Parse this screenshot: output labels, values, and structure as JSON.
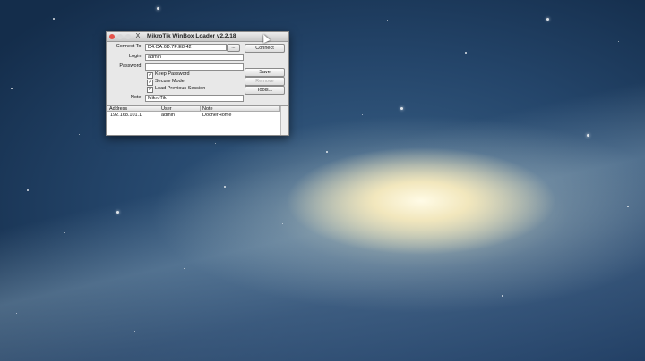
{
  "window": {
    "title": "MikroTik WinBox Loader v2.2.18",
    "tool_icon": "X"
  },
  "form": {
    "connect_to_label": "Connect To:",
    "connect_to_value": "D4:CA:6D:7F:E8:42",
    "browse_label": "...",
    "login_label": "Login:",
    "login_value": "admin",
    "password_label": "Password:",
    "password_value": "",
    "keep_password_label": "Keep Password",
    "secure_mode_label": "Secure Mode",
    "load_previous_label": "Load Previous Session",
    "note_label": "Note:",
    "note_value": "MikroTik",
    "checkbox_mark": "✓"
  },
  "buttons": {
    "connect": "Connect",
    "save": "Save",
    "remove": "Remove",
    "tools": "Tools..."
  },
  "table": {
    "columns": [
      "Address",
      "User",
      "Note"
    ],
    "rows": [
      [
        "192.168.101.1",
        "admin",
        "DocherHome"
      ]
    ]
  },
  "colors": {
    "close_button": "#e5524a",
    "desktop_sky": "#24456a"
  }
}
